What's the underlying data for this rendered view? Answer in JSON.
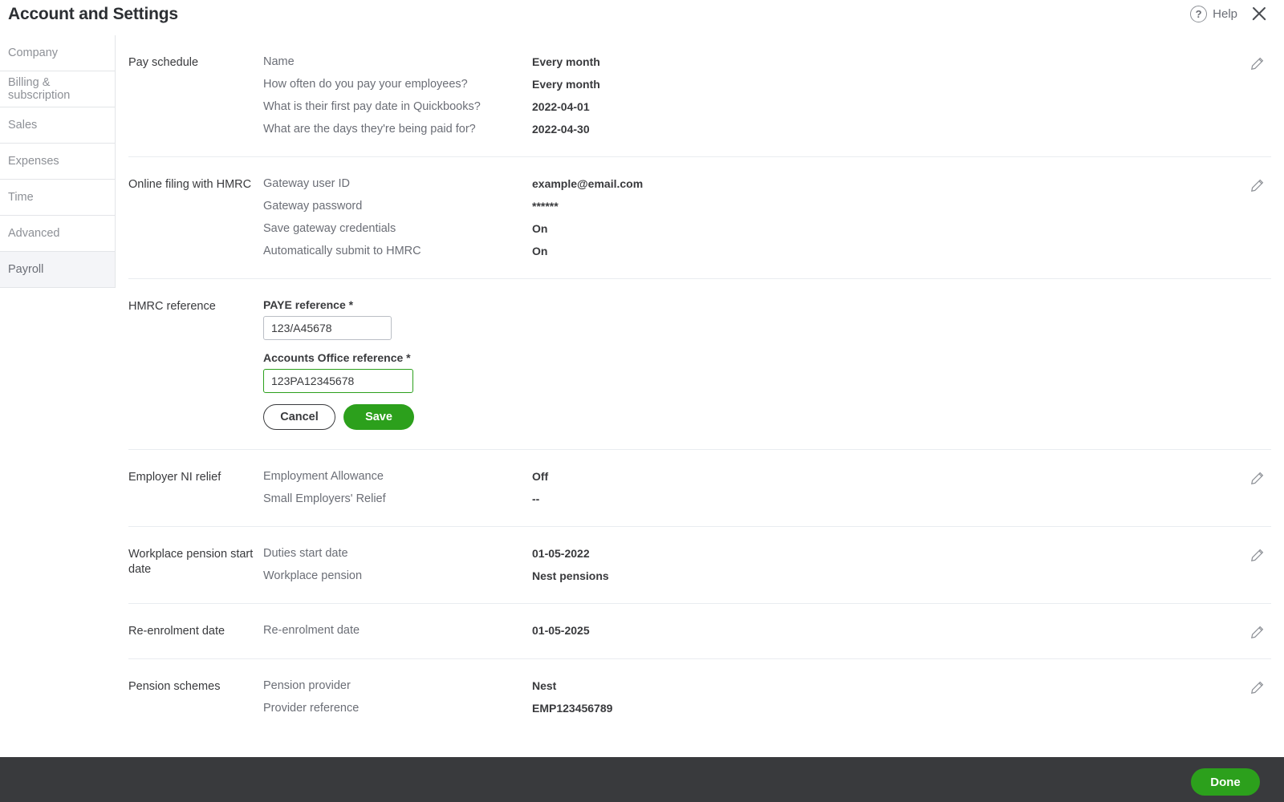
{
  "header": {
    "title": "Account and Settings",
    "help_label": "Help",
    "help_icon": "question-circle-icon",
    "close_icon": "close-icon"
  },
  "sidebar": {
    "items": [
      {
        "label": "Company",
        "active": false
      },
      {
        "label": "Billing & subscription",
        "active": false
      },
      {
        "label": "Sales",
        "active": false
      },
      {
        "label": "Expenses",
        "active": false
      },
      {
        "label": "Time",
        "active": false
      },
      {
        "label": "Advanced",
        "active": false
      },
      {
        "label": "Payroll",
        "active": true
      }
    ]
  },
  "sections": {
    "pay_schedule": {
      "title": "Pay schedule",
      "rows": [
        {
          "label": "Name",
          "value": "Every month"
        },
        {
          "label": "How often do you pay your employees?",
          "value": "Every month"
        },
        {
          "label": "What is their first pay date in Quickbooks?",
          "value": "2022-04-01"
        },
        {
          "label": "What are the days they're being paid for?",
          "value": "2022-04-30"
        }
      ],
      "edit_icon": "pencil-icon"
    },
    "online_filing": {
      "title": "Online filing with HMRC",
      "rows": [
        {
          "label": "Gateway user ID",
          "value": "example@email.com"
        },
        {
          "label": "Gateway password",
          "value": "******"
        },
        {
          "label": "Save gateway credentials",
          "value": "On"
        },
        {
          "label": "Automatically submit to HMRC",
          "value": "On"
        }
      ],
      "edit_icon": "pencil-icon"
    },
    "hmrc_reference": {
      "title": "HMRC reference",
      "paye_label": "PAYE reference *",
      "paye_value": "123/A45678",
      "accounts_office_label": "Accounts Office reference *",
      "accounts_office_value": "123PA12345678",
      "cancel_label": "Cancel",
      "save_label": "Save"
    },
    "employer_ni_relief": {
      "title": "Employer NI relief",
      "rows": [
        {
          "label": "Employment Allowance",
          "value": "Off"
        },
        {
          "label": "Small Employers' Relief",
          "value": "--"
        }
      ],
      "edit_icon": "pencil-icon"
    },
    "workplace_pension": {
      "title": "Workplace pension start date",
      "rows": [
        {
          "label": "Duties start date",
          "value": "01-05-2022"
        },
        {
          "label": "Workplace pension",
          "value": "Nest pensions"
        }
      ],
      "edit_icon": "pencil-icon"
    },
    "re_enrolment": {
      "title": "Re-enrolment date",
      "rows": [
        {
          "label": "Re-enrolment date",
          "value": "01-05-2025"
        }
      ],
      "edit_icon": "pencil-icon"
    },
    "pension_schemes": {
      "title": "Pension schemes",
      "rows": [
        {
          "label": "Pension provider",
          "value": "Nest"
        },
        {
          "label": "Provider reference",
          "value": "EMP123456789"
        }
      ],
      "edit_icon": "pencil-icon"
    }
  },
  "footer": {
    "done_label": "Done"
  },
  "colors": {
    "accent_green": "#2ca01c",
    "footer_dark": "#393a3d",
    "active_nav_bg": "#f4f5f8",
    "divider": "#e9ecf0"
  }
}
